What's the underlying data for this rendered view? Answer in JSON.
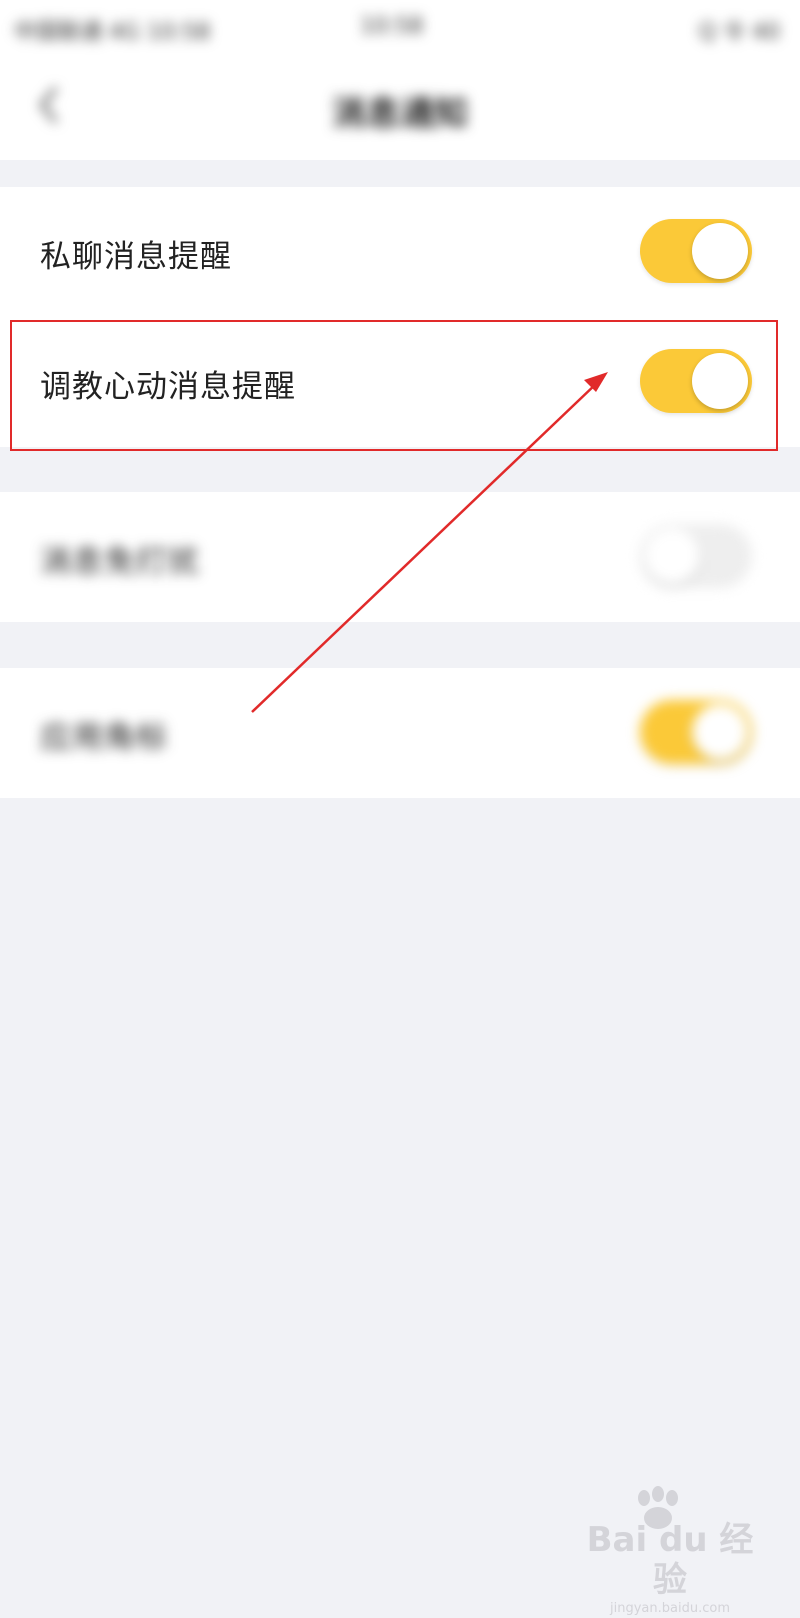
{
  "status_bar": {
    "carrier": "中国联通 4G 10:58",
    "time": "10:58",
    "battery": "Q 令 40"
  },
  "nav": {
    "back_icon": "chevron-left-icon",
    "title": "消息通知"
  },
  "settings": [
    {
      "label": "私聊消息提醒",
      "enabled": true
    },
    {
      "label": "调教心动消息提醒",
      "enabled": true
    },
    {
      "label": "消息免打扰",
      "enabled": false
    },
    {
      "label": "应用角标",
      "enabled": true
    }
  ],
  "colors": {
    "accent": "#fbc938",
    "annotation": "#e12a2a",
    "background": "#f1f2f6"
  },
  "watermark": {
    "brand": "Bai du 经验",
    "domain": "jingyan.baidu.com"
  }
}
